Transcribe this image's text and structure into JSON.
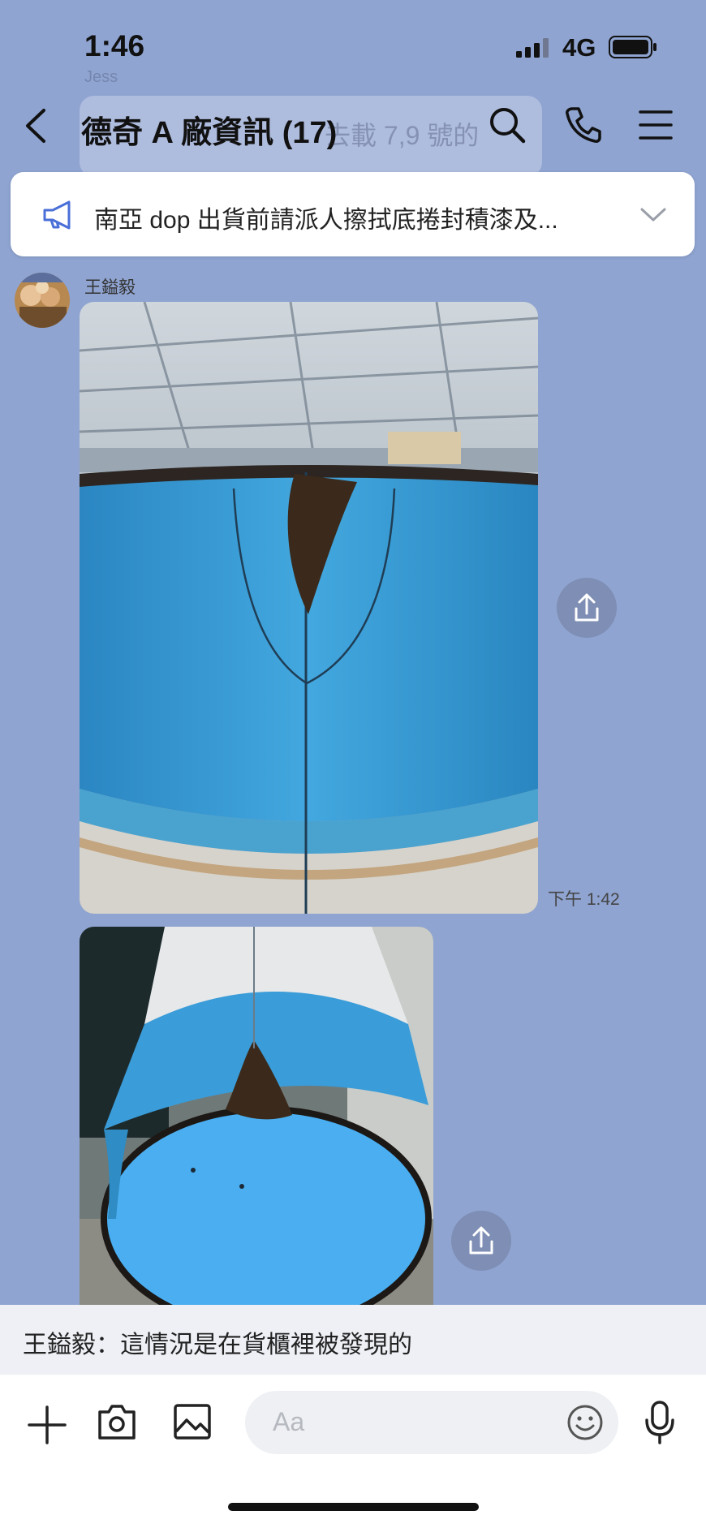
{
  "status_bar": {
    "time": "1:46",
    "network": "4G"
  },
  "ghost": {
    "sender": "Jess",
    "text": "去載 7,9 號的"
  },
  "header": {
    "title": "德奇 A 廠資訊 (17)"
  },
  "announcement": {
    "text": "南亞 dop 出貨前請派人擦拭底捲封積漆及..."
  },
  "messages": [
    {
      "sender": "王鎰毅",
      "time": "下午 1:42"
    }
  ],
  "reply_preview": {
    "text": "王鎰毅：這情況是在貨櫃裡被發現的"
  },
  "input": {
    "placeholder": "Aa"
  },
  "colors": {
    "background": "#8fa4d1",
    "drum_blue": "#3ba0d8",
    "rust": "#3b2a1c"
  }
}
